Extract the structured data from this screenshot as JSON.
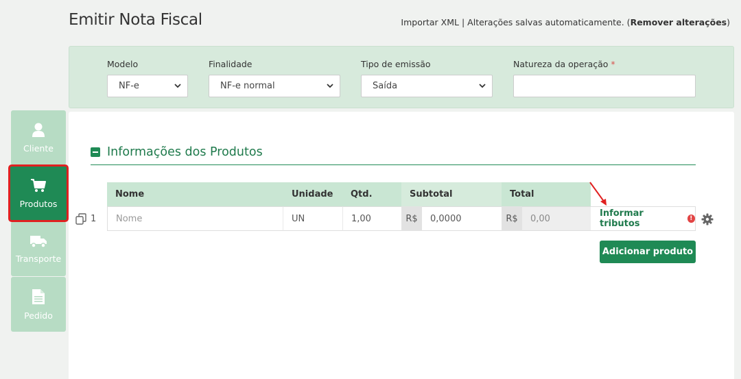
{
  "page": {
    "title": "Emitir Nota Fiscal",
    "import_xml": "Importar XML",
    "separator": "|",
    "autosave": "Alterações salvas automaticamente. (",
    "remove_changes": "Remover alterações",
    "close_paren": ")"
  },
  "header_form": {
    "modelo": {
      "label": "Modelo",
      "value": "NF-e"
    },
    "finalidade": {
      "label": "Finalidade",
      "value": "NF-e normal"
    },
    "tipo_emissao": {
      "label": "Tipo de emissão",
      "value": "Saída"
    },
    "natureza": {
      "label": "Natureza da operação",
      "required_mark": "*",
      "value": ""
    }
  },
  "sidebar": {
    "items": [
      {
        "label": "Cliente",
        "icon": "user-icon"
      },
      {
        "label": "Produtos",
        "icon": "cart-icon",
        "active": true
      },
      {
        "label": "Transporte",
        "icon": "truck-icon"
      },
      {
        "label": "Pedido",
        "icon": "document-icon"
      }
    ]
  },
  "products": {
    "section_title": "Informações dos Produtos",
    "columns": [
      "Nome",
      "Unidade",
      "Qtd.",
      "Subtotal",
      "Total"
    ],
    "rows": [
      {
        "index": "1",
        "nome_placeholder": "Nome",
        "unidade": "UN",
        "qtd": "1,00",
        "currency": "R$",
        "subtotal": "0,0000",
        "total": "0,00",
        "tributos_label": "Informar tributos",
        "warn_glyph": "!"
      }
    ],
    "add_button": "Adicionar produto"
  },
  "colors": {
    "accent_green": "#1f8a55",
    "panel_green": "#d7eadc",
    "sidebar_inactive": "#b7dcc4",
    "highlight_red": "#e02020",
    "warning_red": "#e24444"
  }
}
